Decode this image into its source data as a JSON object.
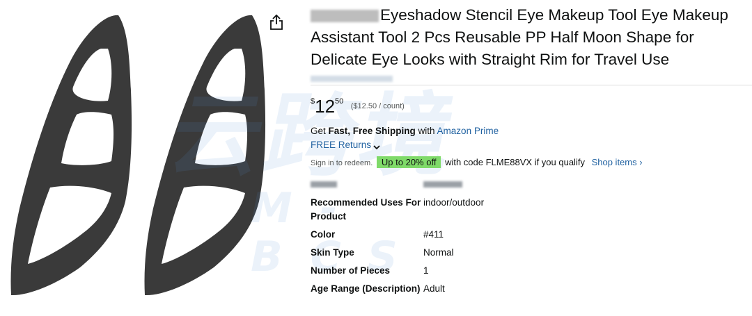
{
  "product": {
    "title_rest": "Eyeshadow Stencil Eye Makeup Tool Eye Makeup Assistant Tool 2 Pcs Reusable PP Half Moon Shape for Delicate Eye Looks with Straight Rim for Travel Use"
  },
  "price": {
    "symbol": "$",
    "whole": "12",
    "fraction": "50",
    "unit_price": "($12.50 / count)"
  },
  "shipping": {
    "prefix": "Get ",
    "bold": "Fast, Free Shipping",
    "middle": " with ",
    "prime_link": "Amazon Prime"
  },
  "returns": {
    "label": "FREE Returns"
  },
  "promo": {
    "signin": "Sign in to redeem.",
    "badge": "Up to 20% off",
    "code_text": " with code FLME88VX if you qualify",
    "shop_link": "Shop items ›"
  },
  "specs": [
    {
      "key": "Recommended Uses For Product",
      "value": "indoor/outdoor"
    },
    {
      "key": "Color",
      "value": "#411"
    },
    {
      "key": "Skin Type",
      "value": "Normal"
    },
    {
      "key": "Number of Pieces",
      "value": "1"
    },
    {
      "key": "Age Range (Description)",
      "value": "Adult"
    }
  ],
  "icons": {
    "share": "share-icon",
    "returns_chevron": "chevron-down-icon"
  },
  "colors": {
    "link": "#2162a1",
    "badge": "#7fda69",
    "stencil": "#3a3a3a"
  },
  "watermark": {
    "main": "云跨境",
    "sub": "M-BCS"
  }
}
